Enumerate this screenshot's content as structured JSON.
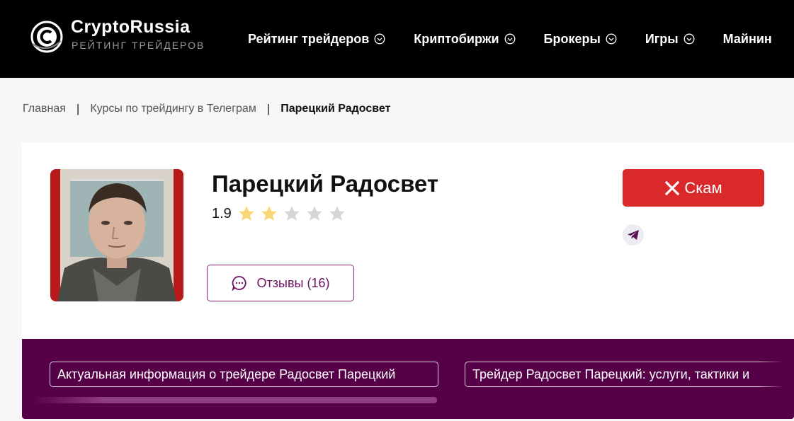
{
  "header": {
    "logo": {
      "title": "CryptoRussia",
      "subtitle": "РЕЙТИНГ ТРЕЙДЕРОВ",
      "icon": "crypto-c-logo-icon"
    },
    "nav": [
      {
        "label": "Рейтинг трейдеров",
        "icon": "chevron-down-circle-icon"
      },
      {
        "label": "Криптобиржи",
        "icon": "chevron-down-circle-icon"
      },
      {
        "label": "Брокеры",
        "icon": "chevron-down-circle-icon"
      },
      {
        "label": "Игры",
        "icon": "chevron-down-circle-icon"
      },
      {
        "label": "Майнин"
      }
    ]
  },
  "breadcrumb": {
    "items": [
      "Главная",
      "Курсы по трейдингу в Телеграм"
    ],
    "separator": "|",
    "current": "Парецкий Радосвет"
  },
  "profile": {
    "name": "Парецкий Радосвет",
    "rating": "1.9",
    "stars_total": 5,
    "stars_filled": 2,
    "reviews_label": "Отзывы (16)",
    "scam_label": "Скам",
    "telegram_icon": "telegram-icon"
  },
  "banner": {
    "tags": [
      "Актуальная информация о трейдере Радосвет Парецкий",
      "Трейдер Радосвет Парецкий: услуги, тактики и"
    ]
  },
  "colors": {
    "header_bg": "#000000",
    "accent_purple": "#560048",
    "scam_red": "#d9292b",
    "star_filled": "#f7d774",
    "star_empty": "#d6d6d6"
  }
}
